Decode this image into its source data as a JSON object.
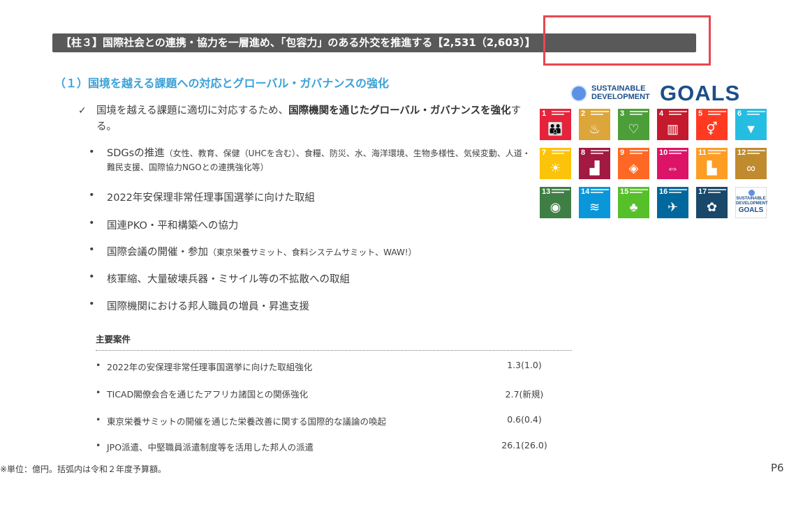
{
  "header": {
    "title": "【柱３】国際社会との連携・協力を一層進め、「包容力」のある外交を推進する【2,531（2,603）】"
  },
  "section": {
    "title": "（１）国境を越える課題への対応とグローバル・ガバナンスの強化"
  },
  "check_item": {
    "mark": "✓",
    "text_before": "国境を越える課題に適切に対応するため、",
    "text_bold": "国際機関を通じたグローバル・ガバナンスを強化",
    "text_after": "する。"
  },
  "bullets": {
    "dot": "•",
    "sdgs_main": "SDGsの推進",
    "sdgs_detail": "（女性、教育、保健（UHCを含む）、食糧、防災、水、海洋環境、生物多様性、気候変動、人道・難民支援、国際協力NGOとの連携強化等）",
    "b2": "2022年安保理非常任理事国選挙に向けた取組",
    "b3": "国連PKO・平和構築への協力",
    "b4_main": "国際会議の開催・参加",
    "b4_detail": "（東京栄養サミット、食料システムサミット、WAW!）",
    "b5": "核軍縮、大量破壊兵器・ミサイル等の不拡散への取組",
    "b6": "国際機関における邦人職員の増員・昇進支援"
  },
  "cases": {
    "title": "主要案件",
    "dot": "•",
    "rows": [
      {
        "label": "2022年の安保理非常任理事国選挙に向けた取組強化",
        "value": "1.3(1.0)"
      },
      {
        "label": "TICAD閣僚会合を通じたアフリカ諸国との関係強化",
        "value": "2.7(新規)"
      },
      {
        "label": "東京栄養サミットの開催を通じた栄養改善に関する国際的な議論の喚起",
        "value": "0.6(0.4)"
      },
      {
        "label": "JPO派遣、中堅職員派遣制度等を活用した邦人の派遣",
        "value": "26.1(26.0)"
      }
    ]
  },
  "footnote": "※単位：億円。括弧内は令和２年度予算額。",
  "page_number": "P6",
  "sdgs": {
    "logo_line1": "SUSTAINABLE",
    "logo_line2": "DEVELOPMENT",
    "logo_goals": "GOALS",
    "tiles": [
      {
        "num": "1",
        "color": "#e5243b",
        "icon": "family-icon",
        "glyph": "👪"
      },
      {
        "num": "2",
        "color": "#dda63a",
        "icon": "bowl-icon",
        "glyph": "♨"
      },
      {
        "num": "3",
        "color": "#4c9f38",
        "icon": "heartbeat-icon",
        "glyph": "♡"
      },
      {
        "num": "4",
        "color": "#c5192d",
        "icon": "book-icon",
        "glyph": "▥"
      },
      {
        "num": "5",
        "color": "#ff3a21",
        "icon": "gender-icon",
        "glyph": "⚥"
      },
      {
        "num": "6",
        "color": "#26bde2",
        "icon": "water-glass-icon",
        "glyph": "▼"
      },
      {
        "num": "7",
        "color": "#fcc30b",
        "icon": "sun-icon",
        "glyph": "☀"
      },
      {
        "num": "8",
        "color": "#a21942",
        "icon": "growth-chart-icon",
        "glyph": "▟"
      },
      {
        "num": "9",
        "color": "#fd6925",
        "icon": "cubes-icon",
        "glyph": "◈"
      },
      {
        "num": "10",
        "color": "#dd1367",
        "icon": "equality-icon",
        "glyph": "⇔"
      },
      {
        "num": "11",
        "color": "#fd9d24",
        "icon": "city-icon",
        "glyph": "▙"
      },
      {
        "num": "12",
        "color": "#bf8b2e",
        "icon": "infinity-icon",
        "glyph": "∞"
      },
      {
        "num": "13",
        "color": "#3f7e44",
        "icon": "eye-globe-icon",
        "glyph": "◉"
      },
      {
        "num": "14",
        "color": "#0a97d9",
        "icon": "fish-icon",
        "glyph": "≋"
      },
      {
        "num": "15",
        "color": "#56c02b",
        "icon": "tree-icon",
        "glyph": "♣"
      },
      {
        "num": "16",
        "color": "#00689d",
        "icon": "dove-icon",
        "glyph": "✈"
      },
      {
        "num": "17",
        "color": "#19486a",
        "icon": "flower-icon",
        "glyph": "✿"
      }
    ],
    "goals_tile_line1": "SUSTAINABLE",
    "goals_tile_line2": "DEVELOPMENT",
    "goals_tile_line3": "GOALS"
  }
}
